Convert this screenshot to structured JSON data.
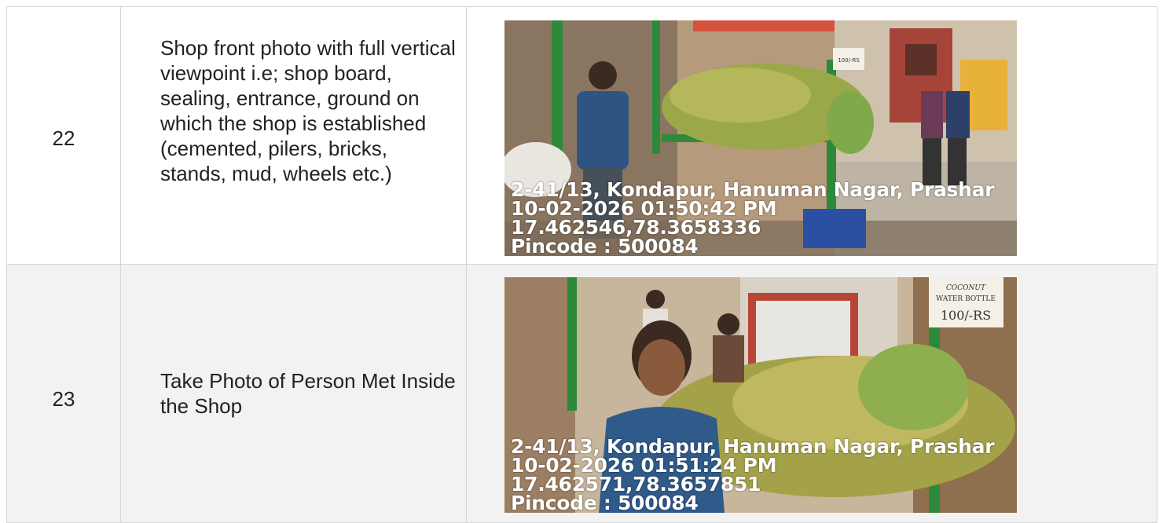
{
  "rows": [
    {
      "number": "22",
      "description": "Shop front photo with full vertical viewpoint i.e; shop board, sealing, entrance, ground on which the shop is established (cemented, pilers, bricks, stands, mud, wheels etc.)",
      "photo": {
        "address": "2-41/13, Kondapur, Hanuman Nagar, Prashar",
        "datetime": "10-02-2026 01:50:42 PM",
        "coords": "17.462546,78.3658336",
        "pincode": "Pincode : 500084",
        "sign_text": "100/-RS"
      }
    },
    {
      "number": "23",
      "description": "Take Photo of Person Met Inside the Shop",
      "photo": {
        "address": "2-41/13, Kondapur, Hanuman Nagar, Prashar",
        "datetime": "10-02-2026 01:51:24 PM",
        "coords": "17.462571,78.3657851",
        "pincode": "Pincode : 500084",
        "sign_line1": "COCONUT",
        "sign_line2": "WATER BOTTLE",
        "sign_line3": "100/-RS"
      }
    }
  ],
  "colors": {
    "border": "#d6d6d6",
    "row_alt_bg": "#f2f2f2",
    "text": "#222222",
    "overlay_text": "#ffffff"
  }
}
